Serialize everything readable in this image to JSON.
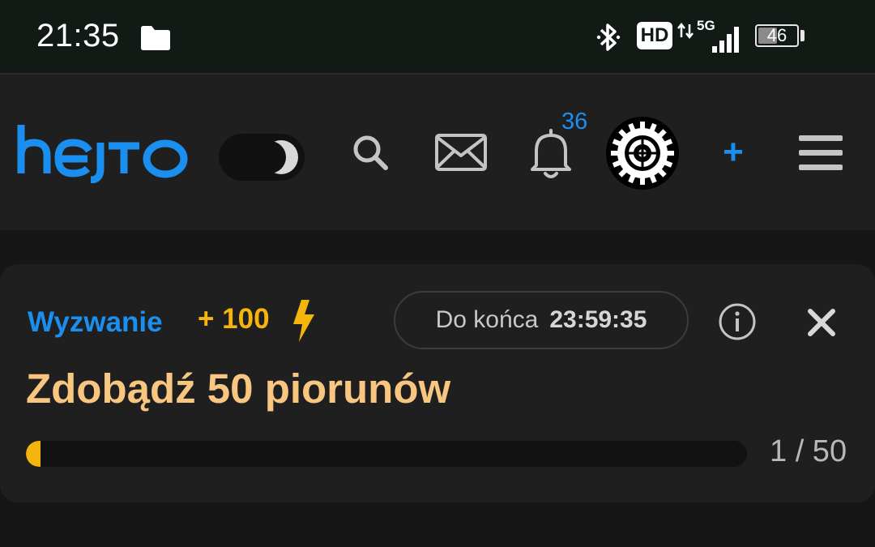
{
  "status_bar": {
    "time": "21:35",
    "hd_label": "HD",
    "network_label": "5G",
    "battery_level": "46"
  },
  "header": {
    "logo_text": "hejto",
    "notification_count": "36",
    "add_label": "+",
    "icons": [
      "dark-mode-toggle",
      "search-icon",
      "mail-icon",
      "bell-icon",
      "avatar",
      "plus-icon",
      "hamburger-menu-icon"
    ]
  },
  "challenge": {
    "label": "Wyzwanie",
    "points": "+ 100",
    "timer_label": "Do końca",
    "timer_value": "23:59:35",
    "title": "Zdobądź 50 piorunów",
    "progress_current": 1,
    "progress_total": 50,
    "progress_text": "1 / 50"
  },
  "colors": {
    "accent_blue": "#1a8fef",
    "accent_yellow": "#f5b50d",
    "title_peach": "#f8c680",
    "background": "#161616",
    "card": "#1f1f1f"
  }
}
